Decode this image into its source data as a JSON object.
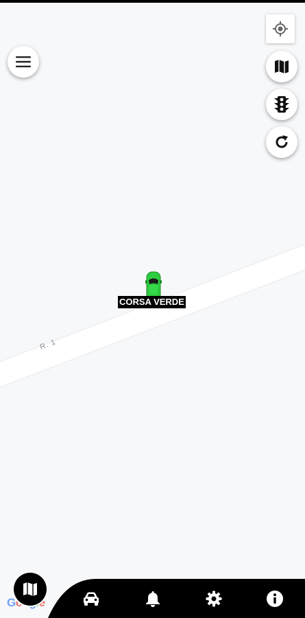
{
  "map": {
    "road_label": "R. 1",
    "vehicle": {
      "label": "CORSA VERDE",
      "color": "#2ecc40",
      "icon": "car-top-icon"
    },
    "attribution": [
      "G",
      "o",
      "o",
      "g",
      "l",
      "e"
    ]
  },
  "controls": {
    "menu": {
      "icon": "menu-icon"
    },
    "locate": {
      "icon": "my-location-icon"
    },
    "map_type": {
      "icon": "map-icon"
    },
    "traffic": {
      "icon": "traffic-light-icon"
    },
    "refresh": {
      "icon": "refresh-icon"
    }
  },
  "bottom_nav": {
    "background": "#000000",
    "items": [
      {
        "name": "map",
        "icon": "map-icon",
        "active": true
      },
      {
        "name": "vehicles",
        "icon": "car-icon",
        "active": false
      },
      {
        "name": "alerts",
        "icon": "bell-icon",
        "active": false
      },
      {
        "name": "settings",
        "icon": "gear-icon",
        "active": false
      },
      {
        "name": "info",
        "icon": "info-icon",
        "active": false
      }
    ]
  }
}
